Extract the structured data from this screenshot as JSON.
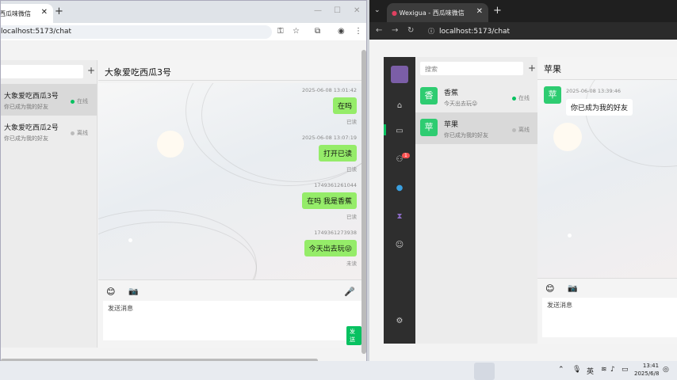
{
  "left_browser": {
    "tab_title": "西瓜味微信",
    "url": "localhost:5173/chat",
    "contacts": [
      {
        "name": "大象爱吃西瓜3号",
        "preview": "你已成为我的好友",
        "status": "在线",
        "status_color": "#07c160"
      },
      {
        "name": "大象爱吃西瓜2号",
        "preview": "你已成为我的好友",
        "status": "离线",
        "status_color": "#bbbbbb"
      }
    ],
    "chat_title": "大象爱吃西瓜3号",
    "messages": [
      {
        "time": "2025-06-08 13:01:42",
        "text": "在吗",
        "status": "已读"
      },
      {
        "time": "2025-06-08 13:07:19",
        "text": "打开已读",
        "status": "已读"
      },
      {
        "time": "1749361261044",
        "text": "在吗 我是香蕉",
        "status": "已读"
      },
      {
        "time": "1749361273938",
        "text": "今天出去玩😜",
        "status": "未读"
      }
    ],
    "input_placeholder": "发送消息",
    "send_label": "发送"
  },
  "right_browser": {
    "tab_title": "Wexigua - 西瓜味微信",
    "url": "localhost:5173/chat",
    "search_placeholder": "搜索",
    "contacts_badge": "1",
    "contacts": [
      {
        "avatar": "香",
        "name": "香蕉",
        "preview": "今天出去玩😜",
        "status": "在线",
        "status_color": "#07c160"
      },
      {
        "avatar": "苹",
        "name": "苹果",
        "preview": "你已成为我的好友",
        "status": "离线",
        "status_color": "#bbbbbb"
      }
    ],
    "chat_title": "苹果",
    "chat_avatar": "苹",
    "messages": [
      {
        "time": "2025-06-08 13:39:46",
        "text": "你已成为我的好友"
      }
    ],
    "input_placeholder": "发送消息"
  },
  "taskbar": {
    "ime": "英",
    "time": "13:41",
    "date": "2025/6/8"
  },
  "colors": {
    "accent": "#07c160",
    "bubble": "#95ec69"
  }
}
